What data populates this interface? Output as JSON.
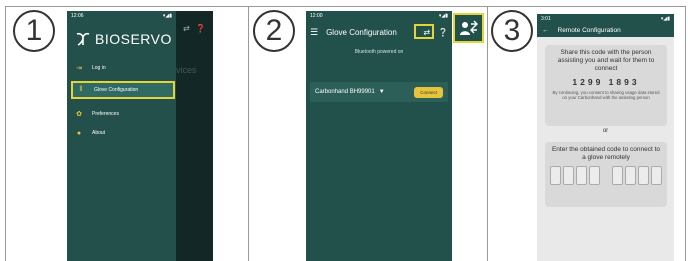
{
  "steps": [
    "1",
    "2",
    "3"
  ],
  "phone1": {
    "status_time": "12:06",
    "logo_text": "BIOSERVO",
    "background_text": "vices",
    "menu": [
      {
        "label": "Log in",
        "icon": "login-icon"
      },
      {
        "label": "Glove Configuration",
        "icon": "glove-config-icon"
      },
      {
        "label": "Preferences",
        "icon": "gear-icon"
      },
      {
        "label": "About",
        "icon": "info-icon"
      }
    ]
  },
  "phone2": {
    "status_time": "12:00",
    "title": "Glove Configuration",
    "bluetooth_status": "Bluetooth powered on",
    "device_name": "Carbonhand BH99901",
    "connect_label": "Connect"
  },
  "phone3": {
    "status_time": "3:01",
    "title": "Remote Configuration",
    "share_text": "Share this code with the person assisting you and wait for them to connect",
    "code": "1299 1893",
    "consent": "By continuing, you consent to sharing usage data stored on your Carbonhand with the assisting person",
    "or_label": "or",
    "enter_text": "Enter the obtained code to connect to a glove remotely"
  },
  "colors": {
    "brand_dark": "#22514b",
    "highlight": "#e4d33b",
    "accent": "#e7c43c"
  }
}
